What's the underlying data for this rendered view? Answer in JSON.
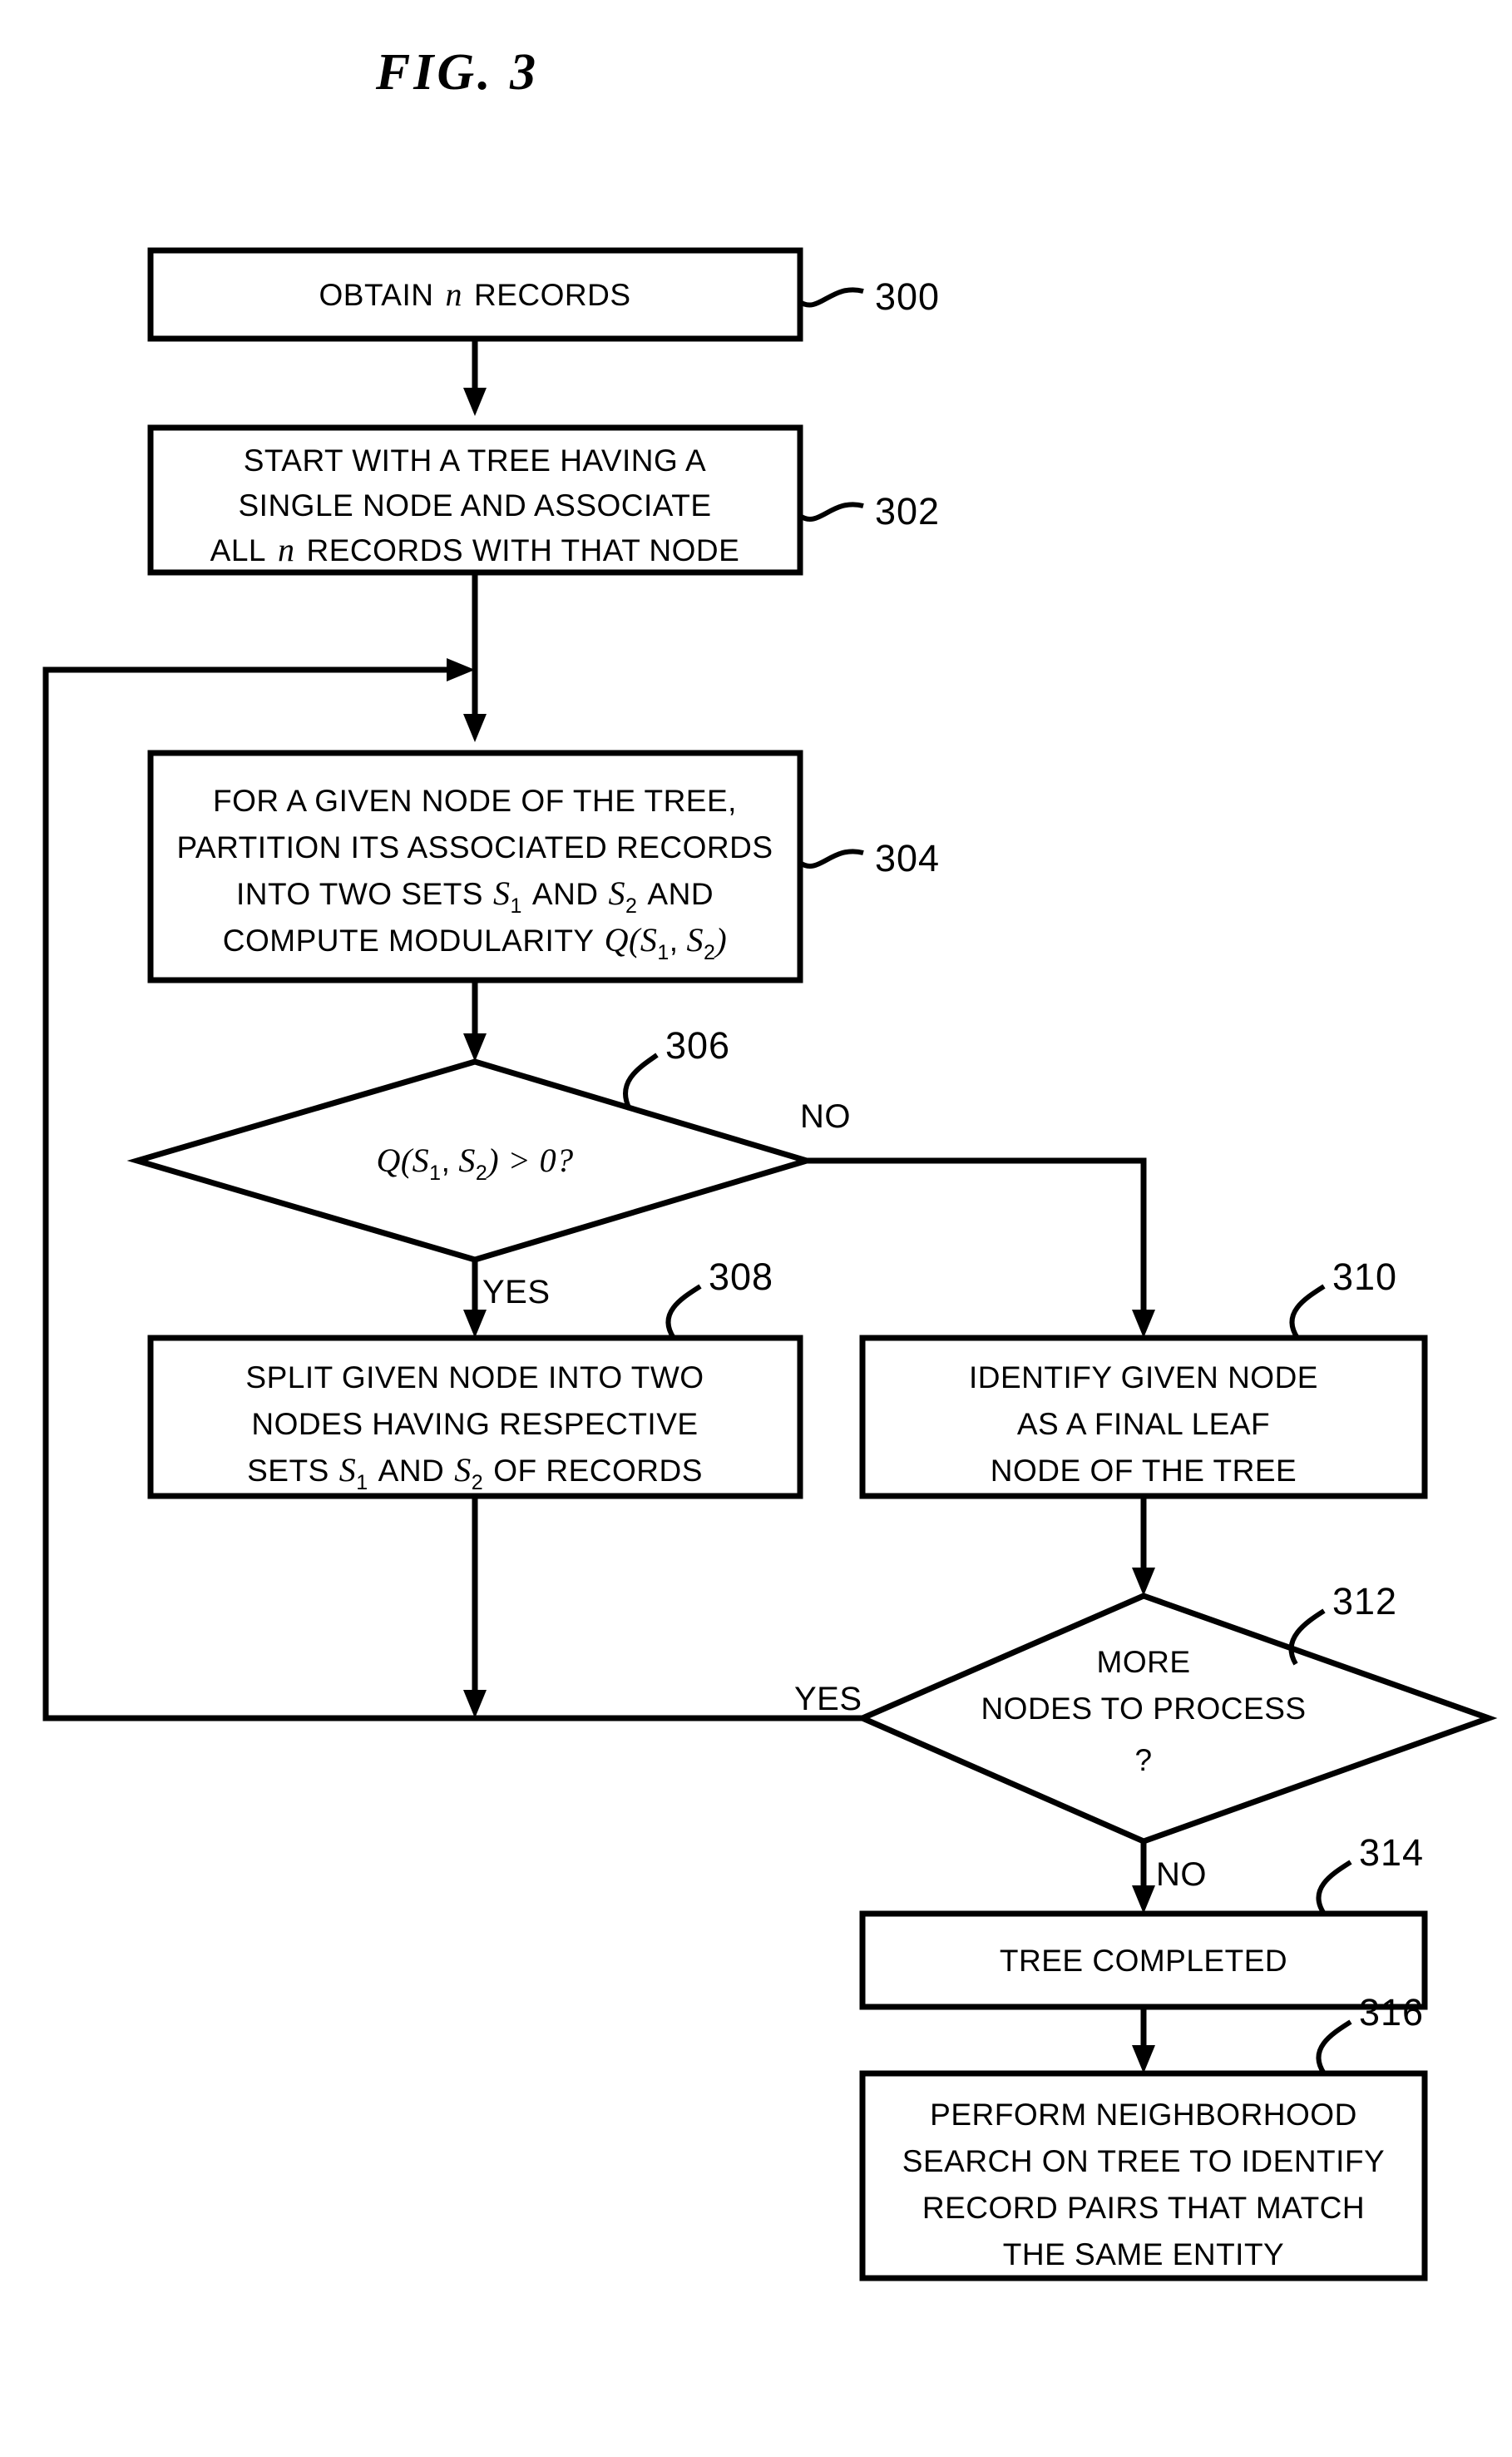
{
  "figure": {
    "title": "FIG. 3",
    "type": "flowchart",
    "domain": "patent-figure",
    "colors": {
      "stroke": "#000000",
      "fill": "#ffffff",
      "background": "#ffffff"
    }
  },
  "nodes": [
    {
      "ref": "300",
      "shape": "rect",
      "lines": [
        "OBTAIN n RECORDS"
      ],
      "text_plain": "OBTAIN n RECORDS",
      "italic_tokens": [
        "n"
      ]
    },
    {
      "ref": "302",
      "shape": "rect",
      "lines": [
        "START WITH A TREE HAVING A",
        "SINGLE NODE AND ASSOCIATE",
        "ALL n RECORDS WITH THAT NODE"
      ],
      "text_plain": "START WITH A TREE HAVING A SINGLE NODE AND ASSOCIATE ALL n RECORDS WITH THAT NODE",
      "italic_tokens": [
        "n"
      ]
    },
    {
      "ref": "304",
      "shape": "rect",
      "lines": [
        "FOR A GIVEN NODE OF THE TREE,",
        "PARTITION ITS ASSOCIATED RECORDS",
        "INTO TWO SETS S1 AND S2 AND",
        "COMPUTE MODULARITY Q(S1, S2)"
      ],
      "text_plain": "FOR A GIVEN NODE OF THE TREE, PARTITION ITS ASSOCIATED RECORDS INTO TWO SETS S1 AND S2 AND COMPUTE MODULARITY Q(S1, S2)",
      "italic_tokens": [
        "S",
        "Q"
      ]
    },
    {
      "ref": "306",
      "shape": "diamond",
      "lines": [
        "Q(S1, S2) > 0?"
      ],
      "text_plain": "Q(S1, S2) > 0?",
      "italic_tokens": [
        "Q",
        "S"
      ]
    },
    {
      "ref": "308",
      "shape": "rect",
      "lines": [
        "SPLIT GIVEN NODE INTO TWO",
        "NODES HAVING RESPECTIVE",
        "SETS S1 AND S2 OF RECORDS"
      ],
      "text_plain": "SPLIT GIVEN NODE INTO TWO NODES HAVING RESPECTIVE SETS S1 AND S2 OF RECORDS",
      "italic_tokens": [
        "S"
      ]
    },
    {
      "ref": "310",
      "shape": "rect",
      "lines": [
        "IDENTIFY GIVEN NODE",
        "AS A FINAL LEAF",
        "NODE OF THE TREE"
      ],
      "text_plain": "IDENTIFY GIVEN NODE AS A FINAL LEAF NODE OF THE TREE",
      "italic_tokens": []
    },
    {
      "ref": "312",
      "shape": "diamond",
      "lines": [
        "MORE",
        "NODES TO PROCESS",
        "?"
      ],
      "text_plain": "MORE NODES TO PROCESS ?",
      "italic_tokens": []
    },
    {
      "ref": "314",
      "shape": "rect",
      "lines": [
        "TREE COMPLETED"
      ],
      "text_plain": "TREE COMPLETED",
      "italic_tokens": []
    },
    {
      "ref": "316",
      "shape": "rect",
      "lines": [
        "PERFORM NEIGHBORHOOD",
        "SEARCH ON TREE TO IDENTIFY",
        "RECORD PAIRS THAT MATCH",
        "THE SAME ENTITY"
      ],
      "text_plain": "PERFORM NEIGHBORHOOD SEARCH ON TREE TO IDENTIFY RECORD PAIRS THAT MATCH THE SAME ENTITY",
      "italic_tokens": []
    }
  ],
  "edges": [
    {
      "from": "300",
      "to": "302",
      "label": ""
    },
    {
      "from": "302",
      "to": "304",
      "label": ""
    },
    {
      "from": "304",
      "to": "306",
      "label": ""
    },
    {
      "from": "306",
      "to": "308",
      "label": "YES"
    },
    {
      "from": "306",
      "to": "310",
      "label": "NO"
    },
    {
      "from": "310",
      "to": "312",
      "label": ""
    },
    {
      "from": "312",
      "to": "304",
      "label": "YES"
    },
    {
      "from": "312",
      "to": "314",
      "label": "NO"
    },
    {
      "from": "314",
      "to": "316",
      "label": ""
    },
    {
      "from": "308",
      "to": "304",
      "label": ""
    }
  ],
  "edge_labels": {
    "yes_306": "YES",
    "no_306": "NO",
    "yes_312": "YES",
    "no_312": "NO"
  },
  "refnums": {
    "n300": "300",
    "n302": "302",
    "n304": "304",
    "n306": "306",
    "n308": "308",
    "n310": "310",
    "n312": "312",
    "n314": "314",
    "n316": "316"
  },
  "box300": {
    "l1": "OBTAIN",
    "it": "n",
    "l1b": "RECORDS"
  },
  "box302": {
    "l1": "START WITH A TREE HAVING A",
    "l2": "SINGLE NODE AND ASSOCIATE",
    "l3a": "ALL",
    "l3it": "n",
    "l3b": "RECORDS WITH THAT NODE"
  },
  "box304": {
    "l1": "FOR A GIVEN NODE OF THE TREE,",
    "l2": "PARTITION ITS ASSOCIATED RECORDS",
    "l3a": "INTO TWO SETS",
    "l3s1": "S",
    "l3sub1": "1",
    "l3mid": "AND",
    "l3s2": "S",
    "l3sub2": "2",
    "l3end": "AND",
    "l4a": "COMPUTE MODULARITY",
    "l4q": "Q(",
    "l4s1": "S",
    "l4sub1": "1",
    "l4comma": ",",
    "l4s2": "S",
    "l4sub2": "2",
    "l4close": ")"
  },
  "box306": {
    "q": "Q(",
    "s1": "S",
    "sub1": "1",
    "comma": ",",
    "s2": "S",
    "sub2": "2",
    "tail": ") > 0?"
  },
  "box308": {
    "l1": "SPLIT GIVEN NODE INTO TWO",
    "l2": "NODES HAVING RESPECTIVE",
    "l3a": "SETS",
    "l3s1": "S",
    "l3sub1": "1",
    "l3mid": "AND",
    "l3s2": "S",
    "l3sub2": "2",
    "l3end": "OF RECORDS"
  },
  "box310": {
    "l1": "IDENTIFY GIVEN NODE",
    "l2": "AS A FINAL LEAF",
    "l3": "NODE OF THE TREE"
  },
  "box312": {
    "l1": "MORE",
    "l2": "NODES TO PROCESS",
    "l3": "?"
  },
  "box314": {
    "l1": "TREE COMPLETED"
  },
  "box316": {
    "l1": "PERFORM NEIGHBORHOOD",
    "l2": "SEARCH ON TREE TO IDENTIFY",
    "l3": "RECORD PAIRS THAT MATCH",
    "l4": "THE SAME ENTITY"
  }
}
